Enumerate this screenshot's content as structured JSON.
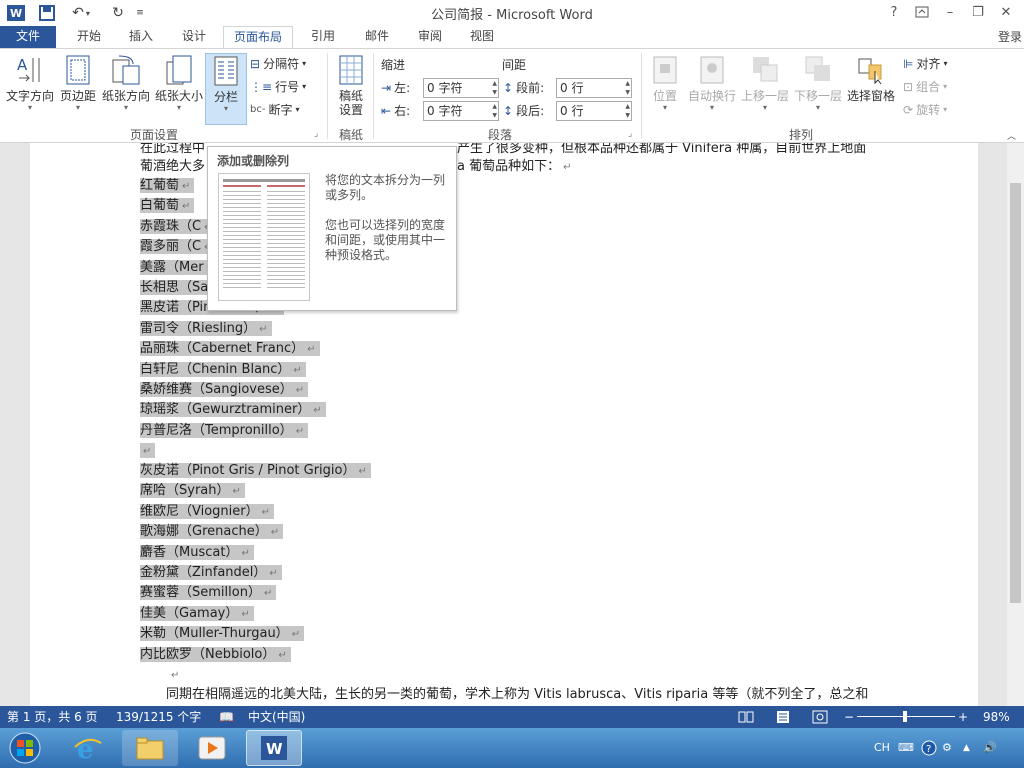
{
  "window": {
    "title": "公司简报 - Microsoft Word",
    "help": "?",
    "minimize": "–",
    "restore": "❐",
    "close": "✕"
  },
  "tabs": {
    "file": "文件",
    "items": [
      "开始",
      "插入",
      "设计",
      "页面布局",
      "引用",
      "邮件",
      "审阅",
      "视图"
    ],
    "active": "页面布局",
    "signin": "登录"
  },
  "ribbon": {
    "page_setup": {
      "text_direction": "文字方向",
      "margins": "页边距",
      "orientation": "纸张方向",
      "size": "纸张大小",
      "columns": "分栏",
      "breaks": "分隔符",
      "line_numbers": "行号",
      "hyphenation": "断字",
      "group_label": "页面设置"
    },
    "paper": {
      "paper_setup_line1": "稿纸",
      "paper_setup_line2": "设置",
      "group_label": "稿纸"
    },
    "paragraph": {
      "indent_header": "缩进",
      "spacing_header": "间距",
      "left_label": "左:",
      "right_label": "右:",
      "before_label": "段前:",
      "after_label": "段后:",
      "left_value": "0 字符",
      "right_value": "0 字符",
      "before_value": "0 行",
      "after_value": "0 行",
      "group_label": "段落"
    },
    "arrange": {
      "position": "位置",
      "wrap_text": "自动换行",
      "bring_forward": "上移一层",
      "send_backward": "下移一层",
      "selection_pane": "选择窗格",
      "align": "对齐",
      "group": "组合",
      "rotate": "旋转",
      "group_label": "排列"
    }
  },
  "tooltip": {
    "title": "添加或删除列",
    "desc1": "将您的文本拆分为一列或多列。",
    "desc2": "您也可以选择列的宽度和间距，或使用其中一种预设格式。"
  },
  "document": {
    "top_line1_left": "在此过程中",
    "top_line1_right": "产生了很多变种，但根本品种还都属于 Vinifera 种属，目前世界上地面",
    "top_line2_left": "葡酒绝大多",
    "top_line2_right": "a 葡萄品种如下：",
    "list_a": [
      "红葡萄",
      "白葡萄",
      "赤霞珠（C",
      "霞多丽（C",
      "美露（Mer",
      "长相思（Sa",
      "黑皮诺（Pinot Noir）",
      "雷司令（Riesling）",
      "品丽珠（Cabernet Franc）",
      "白轩尼（Chenin Blanc）",
      "桑娇维赛（Sangiovese）",
      "琼瑶浆（Gewurztraminer）",
      "丹普尼洛（Tempronillo）"
    ],
    "list_b": [
      "灰皮诺（Pinot Gris / Pinot Grigio）",
      "席哈（Syrah）",
      "维欧尼（Viognier）",
      "歌海娜（Grenache）",
      "麝香（Muscat）",
      "金粉黛（Zinfandel）",
      "赛蜜蓉（Semillon）",
      "佳美（Gamay）",
      "米勒（Muller-Thurgau）",
      "内比欧罗（Nebbiolo）"
    ],
    "bottom_line": "同期在相隔遥远的北美大陆，生长的另一类的葡萄，学术上称为 Vitis labrusca、Vitis riparia 等等（就不列全了，总之和"
  },
  "status": {
    "page": "第 1 页，共 6 页",
    "words": "139/1215 个字",
    "language": "中文(中国)",
    "zoom": "98%"
  },
  "taskbar": {
    "tray_lang": "CH"
  },
  "colors": {
    "accent": "#2b579a",
    "selection": "#c6c6c6"
  }
}
